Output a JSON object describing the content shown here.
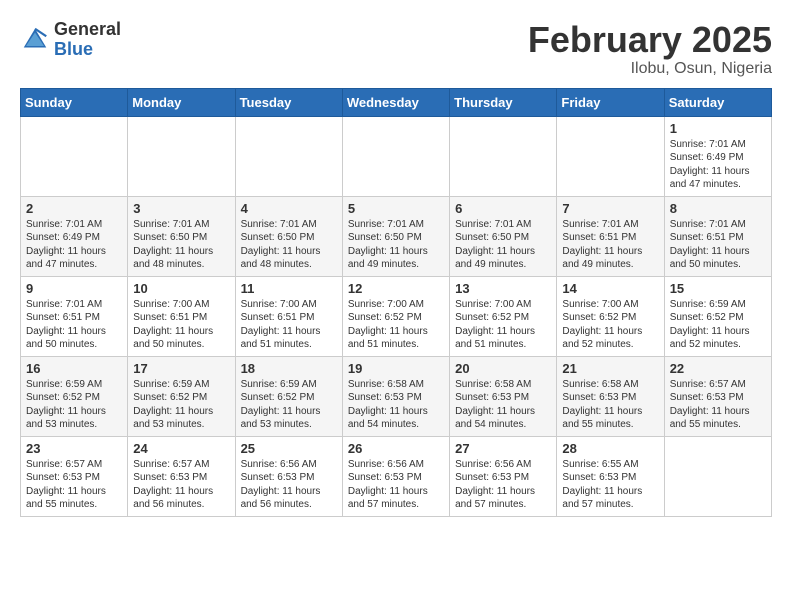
{
  "header": {
    "logo_general": "General",
    "logo_blue": "Blue",
    "title": "February 2025",
    "subtitle": "Ilobu, Osun, Nigeria"
  },
  "weekdays": [
    "Sunday",
    "Monday",
    "Tuesday",
    "Wednesday",
    "Thursday",
    "Friday",
    "Saturday"
  ],
  "weeks": [
    [
      {
        "day": "",
        "info": ""
      },
      {
        "day": "",
        "info": ""
      },
      {
        "day": "",
        "info": ""
      },
      {
        "day": "",
        "info": ""
      },
      {
        "day": "",
        "info": ""
      },
      {
        "day": "",
        "info": ""
      },
      {
        "day": "1",
        "info": "Sunrise: 7:01 AM\nSunset: 6:49 PM\nDaylight: 11 hours and 47 minutes."
      }
    ],
    [
      {
        "day": "2",
        "info": "Sunrise: 7:01 AM\nSunset: 6:49 PM\nDaylight: 11 hours and 47 minutes."
      },
      {
        "day": "3",
        "info": "Sunrise: 7:01 AM\nSunset: 6:50 PM\nDaylight: 11 hours and 48 minutes."
      },
      {
        "day": "4",
        "info": "Sunrise: 7:01 AM\nSunset: 6:50 PM\nDaylight: 11 hours and 48 minutes."
      },
      {
        "day": "5",
        "info": "Sunrise: 7:01 AM\nSunset: 6:50 PM\nDaylight: 11 hours and 49 minutes."
      },
      {
        "day": "6",
        "info": "Sunrise: 7:01 AM\nSunset: 6:50 PM\nDaylight: 11 hours and 49 minutes."
      },
      {
        "day": "7",
        "info": "Sunrise: 7:01 AM\nSunset: 6:51 PM\nDaylight: 11 hours and 49 minutes."
      },
      {
        "day": "8",
        "info": "Sunrise: 7:01 AM\nSunset: 6:51 PM\nDaylight: 11 hours and 50 minutes."
      }
    ],
    [
      {
        "day": "9",
        "info": "Sunrise: 7:01 AM\nSunset: 6:51 PM\nDaylight: 11 hours and 50 minutes."
      },
      {
        "day": "10",
        "info": "Sunrise: 7:00 AM\nSunset: 6:51 PM\nDaylight: 11 hours and 50 minutes."
      },
      {
        "day": "11",
        "info": "Sunrise: 7:00 AM\nSunset: 6:51 PM\nDaylight: 11 hours and 51 minutes."
      },
      {
        "day": "12",
        "info": "Sunrise: 7:00 AM\nSunset: 6:52 PM\nDaylight: 11 hours and 51 minutes."
      },
      {
        "day": "13",
        "info": "Sunrise: 7:00 AM\nSunset: 6:52 PM\nDaylight: 11 hours and 51 minutes."
      },
      {
        "day": "14",
        "info": "Sunrise: 7:00 AM\nSunset: 6:52 PM\nDaylight: 11 hours and 52 minutes."
      },
      {
        "day": "15",
        "info": "Sunrise: 6:59 AM\nSunset: 6:52 PM\nDaylight: 11 hours and 52 minutes."
      }
    ],
    [
      {
        "day": "16",
        "info": "Sunrise: 6:59 AM\nSunset: 6:52 PM\nDaylight: 11 hours and 53 minutes."
      },
      {
        "day": "17",
        "info": "Sunrise: 6:59 AM\nSunset: 6:52 PM\nDaylight: 11 hours and 53 minutes."
      },
      {
        "day": "18",
        "info": "Sunrise: 6:59 AM\nSunset: 6:52 PM\nDaylight: 11 hours and 53 minutes."
      },
      {
        "day": "19",
        "info": "Sunrise: 6:58 AM\nSunset: 6:53 PM\nDaylight: 11 hours and 54 minutes."
      },
      {
        "day": "20",
        "info": "Sunrise: 6:58 AM\nSunset: 6:53 PM\nDaylight: 11 hours and 54 minutes."
      },
      {
        "day": "21",
        "info": "Sunrise: 6:58 AM\nSunset: 6:53 PM\nDaylight: 11 hours and 55 minutes."
      },
      {
        "day": "22",
        "info": "Sunrise: 6:57 AM\nSunset: 6:53 PM\nDaylight: 11 hours and 55 minutes."
      }
    ],
    [
      {
        "day": "23",
        "info": "Sunrise: 6:57 AM\nSunset: 6:53 PM\nDaylight: 11 hours and 55 minutes."
      },
      {
        "day": "24",
        "info": "Sunrise: 6:57 AM\nSunset: 6:53 PM\nDaylight: 11 hours and 56 minutes."
      },
      {
        "day": "25",
        "info": "Sunrise: 6:56 AM\nSunset: 6:53 PM\nDaylight: 11 hours and 56 minutes."
      },
      {
        "day": "26",
        "info": "Sunrise: 6:56 AM\nSunset: 6:53 PM\nDaylight: 11 hours and 57 minutes."
      },
      {
        "day": "27",
        "info": "Sunrise: 6:56 AM\nSunset: 6:53 PM\nDaylight: 11 hours and 57 minutes."
      },
      {
        "day": "28",
        "info": "Sunrise: 6:55 AM\nSunset: 6:53 PM\nDaylight: 11 hours and 57 minutes."
      },
      {
        "day": "",
        "info": ""
      }
    ]
  ]
}
